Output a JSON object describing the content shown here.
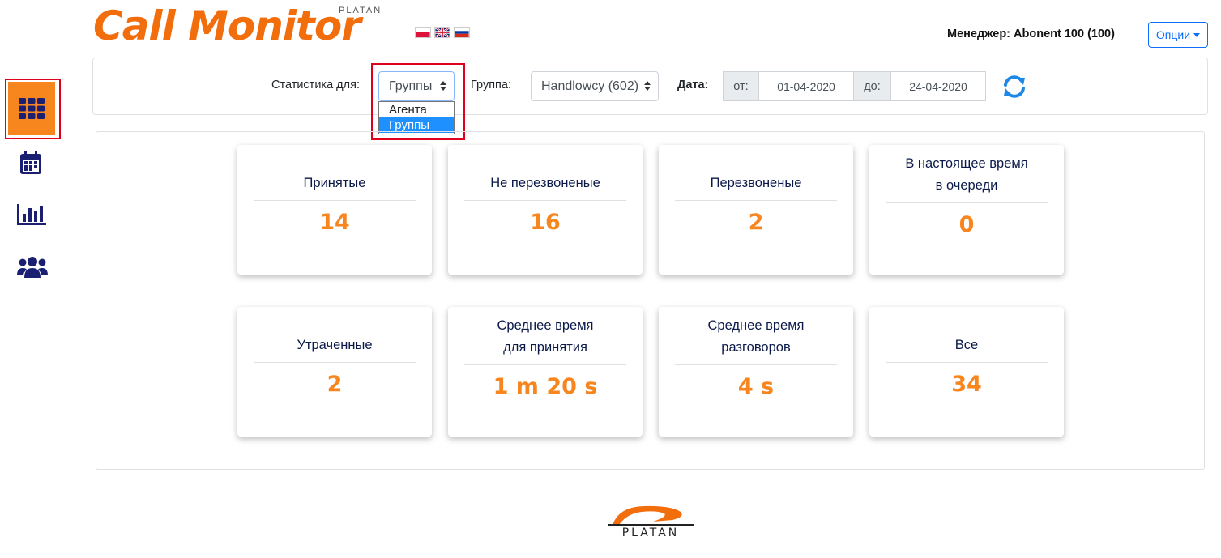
{
  "header": {
    "logo_text": "Call Monitor",
    "logo_brand": "PLATAN",
    "manager_label": "Менеджер:",
    "manager_value": "Abonent 100 (100)",
    "options_label": "Опции"
  },
  "languages": [
    "pl-flag-icon",
    "gb-flag-icon",
    "ru-flag-icon"
  ],
  "sidebar": {
    "items": [
      {
        "icon": "grid-icon",
        "active": true
      },
      {
        "icon": "calendar-icon",
        "active": false
      },
      {
        "icon": "bar-chart-icon",
        "active": false
      },
      {
        "icon": "users-icon",
        "active": false
      }
    ]
  },
  "filters": {
    "stats_for_label": "Статистика для:",
    "stats_for_value": "Группы",
    "stats_for_options": [
      "Агента",
      "Группы"
    ],
    "group_label": "Группа:",
    "group_value": "Handlowcy (602)",
    "date_label": "Дата:",
    "from_label": "от:",
    "from_value": "01-04-2020",
    "to_label": "до:",
    "to_value": "24-04-2020"
  },
  "stats": [
    {
      "title1": "Принятые",
      "title2": "",
      "value": "14"
    },
    {
      "title1": "Не перезвоненые",
      "title2": "",
      "value": "16"
    },
    {
      "title1": "Перезвоненые",
      "title2": "",
      "value": "2"
    },
    {
      "title1": "В настоящее время",
      "title2": "в очереди",
      "value": "0"
    },
    {
      "title1": "Утраченные",
      "title2": "",
      "value": "2"
    },
    {
      "title1": "Среднее время",
      "title2": "для принятия",
      "value": "1 m 20 s"
    },
    {
      "title1": "Среднее время",
      "title2": "разговоров",
      "value": "4 s"
    },
    {
      "title1": "Все",
      "title2": "",
      "value": "34"
    }
  ],
  "footer": {
    "brand": "PLATAN"
  },
  "colors": {
    "accent": "#f7861f",
    "logo": "#f26d0c",
    "nav_icon": "#1a1f71",
    "highlight": "#e0001b",
    "link": "#0d6efd"
  }
}
